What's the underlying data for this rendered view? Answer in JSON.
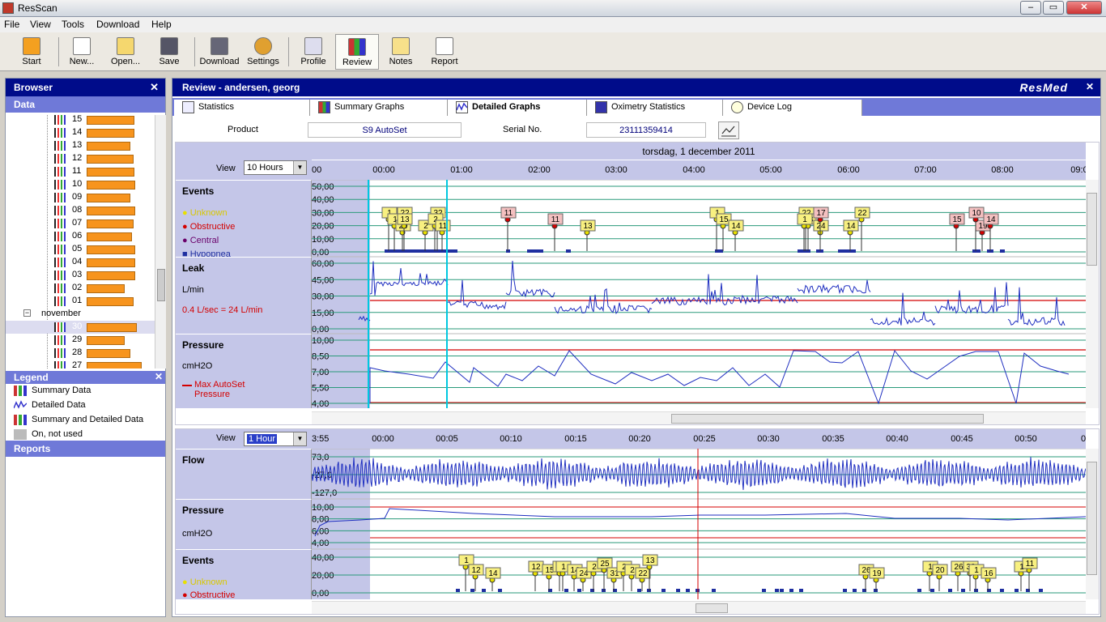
{
  "window": {
    "title": "ResScan",
    "min": "–",
    "max": "▭",
    "close": "✕"
  },
  "menu": [
    "File",
    "View",
    "Tools",
    "Download",
    "Help"
  ],
  "toolbar": [
    {
      "label": "Start",
      "icon": "start-icon"
    },
    {
      "label": "New...",
      "icon": "new-icon"
    },
    {
      "label": "Open...",
      "icon": "open-icon"
    },
    {
      "label": "Save",
      "icon": "save-icon"
    },
    {
      "label": "Download",
      "icon": "download-icon"
    },
    {
      "label": "Settings",
      "icon": "settings-icon"
    },
    {
      "label": "Profile",
      "icon": "profile-icon"
    },
    {
      "label": "Review",
      "icon": "review-icon"
    },
    {
      "label": "Notes",
      "icon": "notes-icon"
    },
    {
      "label": "Report",
      "icon": "report-icon"
    }
  ],
  "browser": {
    "title": "Browser",
    "close": "✕",
    "section": "Data",
    "days": [
      {
        "label": "15",
        "bar": 0.78
      },
      {
        "label": "14",
        "bar": 0.78
      },
      {
        "label": "13",
        "bar": 0.72
      },
      {
        "label": "12",
        "bar": 0.77
      },
      {
        "label": "11",
        "bar": 0.78
      },
      {
        "label": "10",
        "bar": 0.8
      },
      {
        "label": "09",
        "bar": 0.72
      },
      {
        "label": "08",
        "bar": 0.8
      },
      {
        "label": "07",
        "bar": 0.77
      },
      {
        "label": "06",
        "bar": 0.75
      },
      {
        "label": "05",
        "bar": 0.8
      },
      {
        "label": "04",
        "bar": 0.8
      },
      {
        "label": "03",
        "bar": 0.8
      },
      {
        "label": "02",
        "bar": 0.62
      },
      {
        "label": "01",
        "bar": 0.77
      }
    ],
    "month": "november",
    "month_days": [
      {
        "label": "30",
        "bar": 0.83
      },
      {
        "label": "29",
        "bar": 0.63
      },
      {
        "label": "28",
        "bar": 0.72
      },
      {
        "label": "27",
        "bar": 0.9
      }
    ]
  },
  "legend": {
    "title": "Legend",
    "close": "✕",
    "items": [
      "Summary Data",
      "Detailed Data",
      "Summary and Detailed Data",
      "On, not used"
    ]
  },
  "reports": {
    "title": "Reports"
  },
  "review": {
    "title": "Review - andersen, georg",
    "logo": "ResMed",
    "close": "✕",
    "tabs": [
      "Statistics",
      "Summary Graphs",
      "Detailed Graphs",
      "Oximetry Statistics",
      "Device Log"
    ],
    "product_label": "Product",
    "product": "S9 AutoSet",
    "serial_label": "Serial No.",
    "serial": "23111359414",
    "date": "torsdag, 1 december 2011",
    "upper": {
      "view_label": "View",
      "view": "10 Hours",
      "time_ticks": [
        "00",
        "00:00",
        "01:00",
        "02:00",
        "03:00",
        "04:00",
        "05:00",
        "06:00",
        "07:00",
        "08:00",
        "09:0"
      ],
      "events": {
        "title": "Events",
        "y_ticks": [
          "50,00",
          "40,00",
          "30,00",
          "20,00",
          "10,00",
          "0,00"
        ],
        "legend": [
          {
            "label": "Unknown",
            "color": "#e8e000"
          },
          {
            "label": "Obstructive",
            "color": "#d40000"
          },
          {
            "label": "Central",
            "color": "#6a006a"
          },
          {
            "label": "Hypopnea",
            "color": "#1f2fa0"
          }
        ],
        "markers": [
          [
            "1",
            475,
            "u"
          ],
          [
            "1",
            482,
            "u"
          ],
          [
            "29",
            492,
            "u"
          ],
          [
            "22",
            494,
            "u"
          ],
          [
            "13",
            494,
            "u"
          ],
          [
            "2",
            520,
            "u"
          ],
          [
            "32",
            535,
            "u"
          ],
          [
            "2",
            532,
            "u"
          ],
          [
            "11",
            541,
            "u"
          ],
          [
            "11",
            622,
            "o"
          ],
          [
            "11",
            680,
            "o"
          ],
          [
            "13",
            720,
            "u"
          ],
          [
            "1",
            880,
            "u"
          ],
          [
            "15",
            888,
            "u"
          ],
          [
            "14",
            903,
            "u"
          ],
          [
            "22",
            990,
            "u"
          ],
          [
            "28",
            993,
            "u"
          ],
          [
            "24",
            1008,
            "u"
          ],
          [
            "17",
            1008,
            "o"
          ],
          [
            "1",
            988,
            "u"
          ],
          [
            "14",
            1045,
            "u"
          ],
          [
            "22",
            1059,
            "u"
          ],
          [
            "15",
            1176,
            "o"
          ],
          [
            "19",
            1208,
            "o"
          ],
          [
            "10",
            1200,
            "o"
          ],
          [
            "14",
            1218,
            "o"
          ]
        ]
      },
      "leak": {
        "title": "Leak",
        "unit": "L/min",
        "y_ticks": [
          "60,00",
          "45,00",
          "30,00",
          "15,00",
          "0,00"
        ],
        "note": "0.4 L/sec = 24 L/min"
      },
      "pressure": {
        "title": "Pressure",
        "unit": "cmH2O",
        "y_ticks": [
          "10,00",
          "8,50",
          "7,00",
          "5,50",
          "4,00"
        ],
        "note": "Max AutoSet Pressure"
      }
    },
    "lower": {
      "view_label": "View",
      "view": "1 Hour",
      "time_ticks": [
        "3:55",
        "00:00",
        "00:05",
        "00:10",
        "00:15",
        "00:20",
        "00:25",
        "00:30",
        "00:35",
        "00:40",
        "00:45",
        "00:50",
        "0"
      ],
      "flow": {
        "title": "Flow",
        "y_ticks": [
          "73,0",
          "-27,0",
          "-127,0"
        ]
      },
      "pressure": {
        "title": "Pressure",
        "unit": "cmH2O",
        "y_ticks": [
          "10,00",
          "8,00",
          "6,00",
          "4,00"
        ]
      },
      "events": {
        "title": "Events",
        "y_ticks": [
          "40,00",
          "20,00",
          "0,00"
        ],
        "legend": [
          "Unknown",
          "Obstructive"
        ],
        "markers": [
          [
            "1",
            570
          ],
          [
            "12",
            582
          ],
          [
            "14",
            603
          ],
          [
            "12",
            656
          ],
          [
            "15",
            673
          ],
          [
            "2",
            686
          ],
          [
            "1",
            690
          ],
          [
            "14",
            704
          ],
          [
            "24",
            715
          ],
          [
            "2",
            728
          ],
          [
            "25",
            741
          ],
          [
            "31",
            753
          ],
          [
            "2",
            765
          ],
          [
            "2",
            775
          ],
          [
            "22",
            788
          ],
          [
            "13",
            797
          ],
          [
            "26",
            1064
          ],
          [
            "19",
            1077
          ],
          [
            "1",
            1143
          ],
          [
            "20",
            1155
          ],
          [
            "26",
            1178
          ],
          [
            "32",
            1193
          ],
          [
            "1",
            1200
          ],
          [
            "16",
            1215
          ],
          [
            "1",
            1256
          ],
          [
            "11",
            1266
          ]
        ]
      }
    }
  }
}
